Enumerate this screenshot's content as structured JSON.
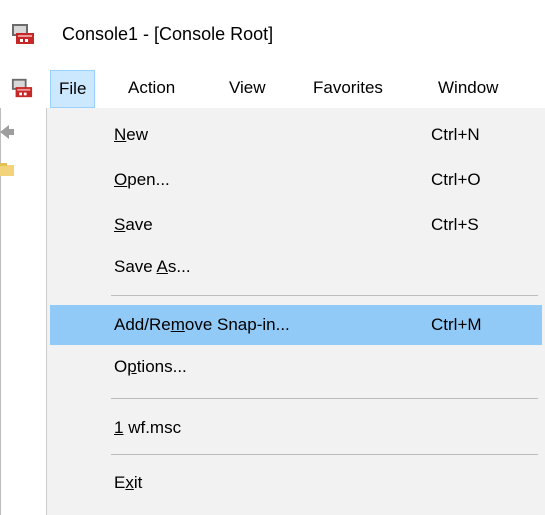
{
  "window": {
    "title": "Console1 - [Console Root]"
  },
  "icons": {
    "app_icon": "mmc-console-icon",
    "back_arrow": "back-arrow-icon",
    "folder": "folder-icon"
  },
  "colors": {
    "menu_open_bg": "#cce8ff",
    "menu_open_border": "#99d1ff",
    "dropdown_bg": "#f2f2f2",
    "highlight_bg": "#91c9f7"
  },
  "menubar": {
    "items": [
      {
        "label": "File",
        "open": true
      },
      {
        "label": "Action",
        "open": false
      },
      {
        "label": "View",
        "open": false
      },
      {
        "label": "Favorites",
        "open": false
      },
      {
        "label": "Window",
        "open": false
      }
    ]
  },
  "file_menu": {
    "items": [
      {
        "label": "New",
        "mnemonic": "N",
        "shortcut": "Ctrl+N",
        "highlighted": false
      },
      {
        "label": "Open...",
        "mnemonic": "O",
        "shortcut": "Ctrl+O",
        "highlighted": false
      },
      {
        "label": "Save",
        "mnemonic": "S",
        "shortcut": "Ctrl+S",
        "highlighted": false
      },
      {
        "label": "Save As...",
        "mnemonic": "A",
        "shortcut": "",
        "highlighted": false
      },
      {
        "label": "Add/Remove Snap-in...",
        "mnemonic": "m",
        "shortcut": "Ctrl+M",
        "highlighted": true
      },
      {
        "label": "Options...",
        "mnemonic": "p",
        "shortcut": "",
        "highlighted": false
      },
      {
        "label": "1 wf.msc",
        "mnemonic": "1",
        "shortcut": "",
        "highlighted": false
      },
      {
        "label": "Exit",
        "mnemonic": "x",
        "shortcut": "",
        "highlighted": false
      }
    ]
  }
}
